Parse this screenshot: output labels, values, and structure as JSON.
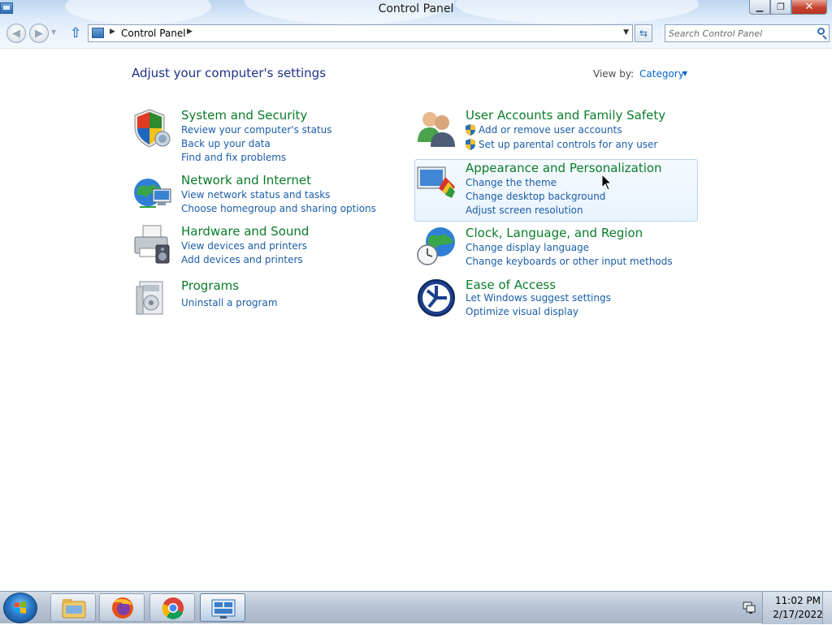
{
  "window": {
    "title": "Control Panel",
    "minimize_label": "▁",
    "restore_label": "❐",
    "close_label": "✕"
  },
  "nav": {
    "back_label": "◀",
    "forward_label": "▶",
    "breadcrumb": [
      "Control Panel"
    ],
    "search_placeholder": "Search Control Panel"
  },
  "content": {
    "heading": "Adjust your computer's settings",
    "view_by_label": "View by:",
    "view_by_value": "Category",
    "left_categories": [
      {
        "title": "System and Security",
        "icon": "shield-icon",
        "links": [
          "Review your computer's status",
          "Back up your data",
          "Find and fix problems"
        ]
      },
      {
        "title": "Network and Internet",
        "icon": "globe-network-icon",
        "links": [
          "View network status and tasks",
          "Choose homegroup and sharing options"
        ]
      },
      {
        "title": "Hardware and Sound",
        "icon": "printer-speaker-icon",
        "links": [
          "View devices and printers",
          "Add devices and printers"
        ]
      },
      {
        "title": "Programs",
        "icon": "programs-icon",
        "links": [
          "Uninstall a program"
        ]
      }
    ],
    "right_categories": [
      {
        "title": "User Accounts and Family Safety",
        "icon": "users-icon",
        "links": [
          "Add or remove user accounts",
          "Set up parental controls for any user"
        ]
      },
      {
        "title": "Appearance and Personalization",
        "icon": "appearance-icon",
        "links": [
          "Change the theme",
          "Change desktop background",
          "Adjust screen resolution"
        ]
      },
      {
        "title": "Clock, Language, and Region",
        "icon": "clock-globe-icon",
        "links": [
          "Change display language",
          "Change keyboards or other input methods"
        ]
      },
      {
        "title": "Ease of Access",
        "icon": "ease-of-access-icon",
        "links": [
          "Let Windows suggest settings",
          "Optimize visual display"
        ]
      }
    ]
  },
  "taskbar": {
    "pinned": [
      "file-explorer-icon",
      "firefox-icon",
      "chrome-icon",
      "control-panel-icon"
    ],
    "time": "11:02 PM",
    "date": "2/17/2022"
  },
  "colors": {
    "category_title": "#0a7c2a",
    "link": "#1a5da8",
    "heading": "#1e3287"
  }
}
